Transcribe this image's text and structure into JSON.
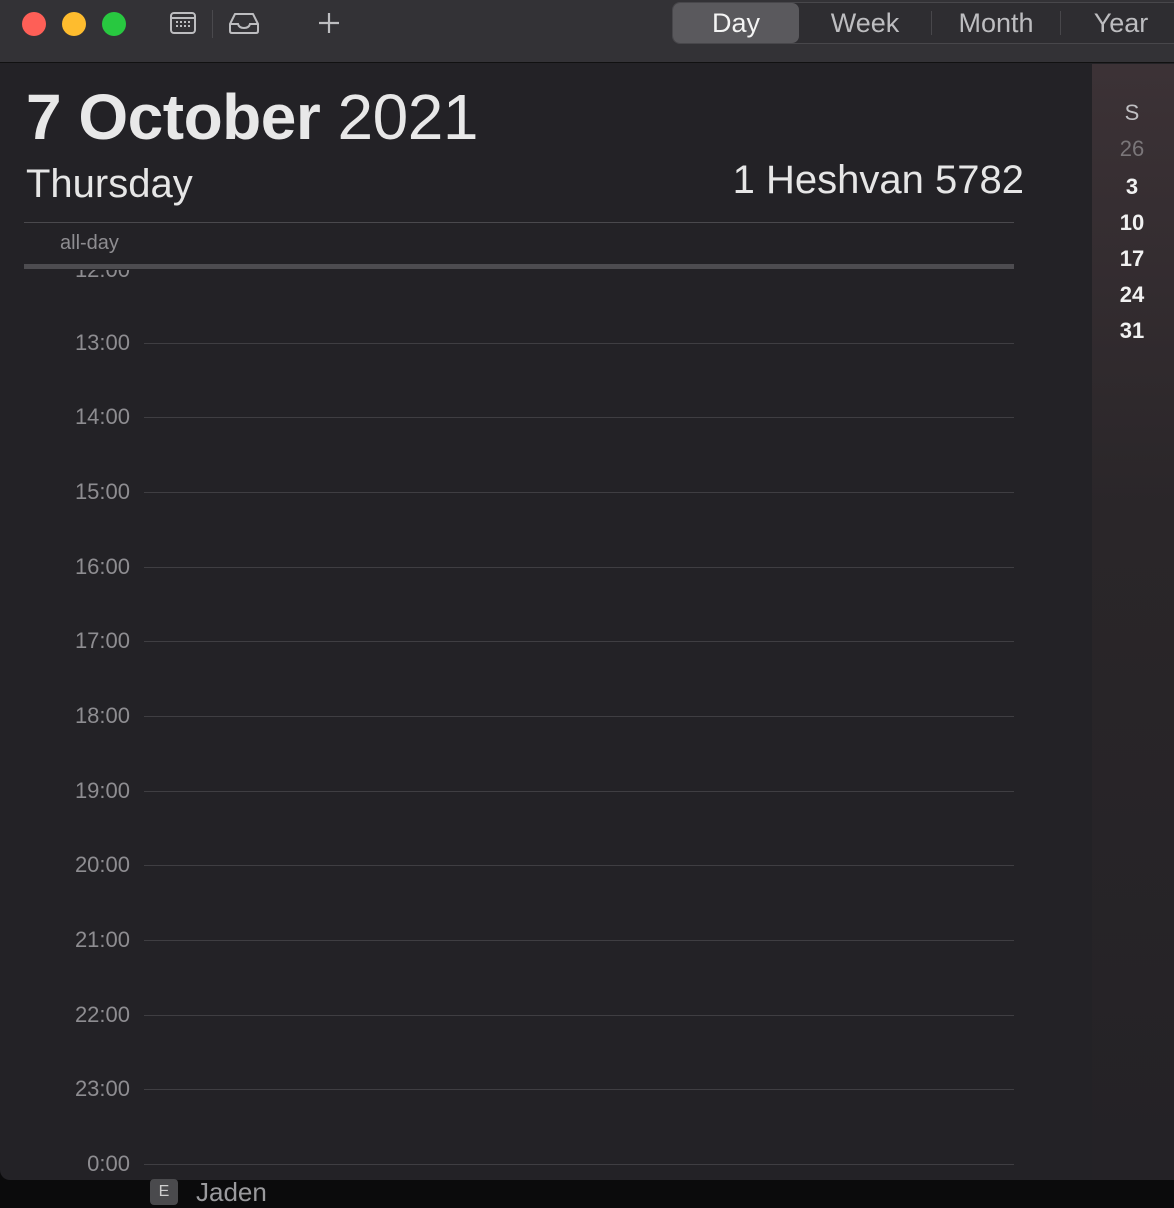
{
  "toolbar": {
    "view_tabs": [
      {
        "label": "Day",
        "active": true
      },
      {
        "label": "Week",
        "active": false
      },
      {
        "label": "Month",
        "active": false
      },
      {
        "label": "Year",
        "active": false
      }
    ],
    "icons": [
      "calendar-list-icon",
      "inbox-icon",
      "plus-icon"
    ]
  },
  "header": {
    "date_bold": "7 October",
    "year": "2021",
    "weekday": "Thursday",
    "alt_calendar": "1 Heshvan 5782",
    "allday_label": "all-day"
  },
  "timeline": {
    "partial_hour": "12:00",
    "hours": [
      "13:00",
      "14:00",
      "15:00",
      "16:00",
      "17:00",
      "18:00",
      "19:00",
      "20:00",
      "21:00",
      "22:00",
      "23:00",
      "0:00"
    ]
  },
  "mini_calendar": {
    "weekday_header": "S",
    "days": [
      {
        "label": "26",
        "dim": true
      },
      {
        "label": "3",
        "dim": false
      },
      {
        "label": "10",
        "dim": false
      },
      {
        "label": "17",
        "dim": false
      },
      {
        "label": "24",
        "dim": false
      },
      {
        "label": "31",
        "dim": false
      }
    ]
  },
  "footer": {
    "badge": "E",
    "name": "Jaden"
  },
  "colors": {
    "close": "#fe5f57",
    "minimize": "#febc2e",
    "zoom": "#28c840",
    "background": "#232226"
  }
}
